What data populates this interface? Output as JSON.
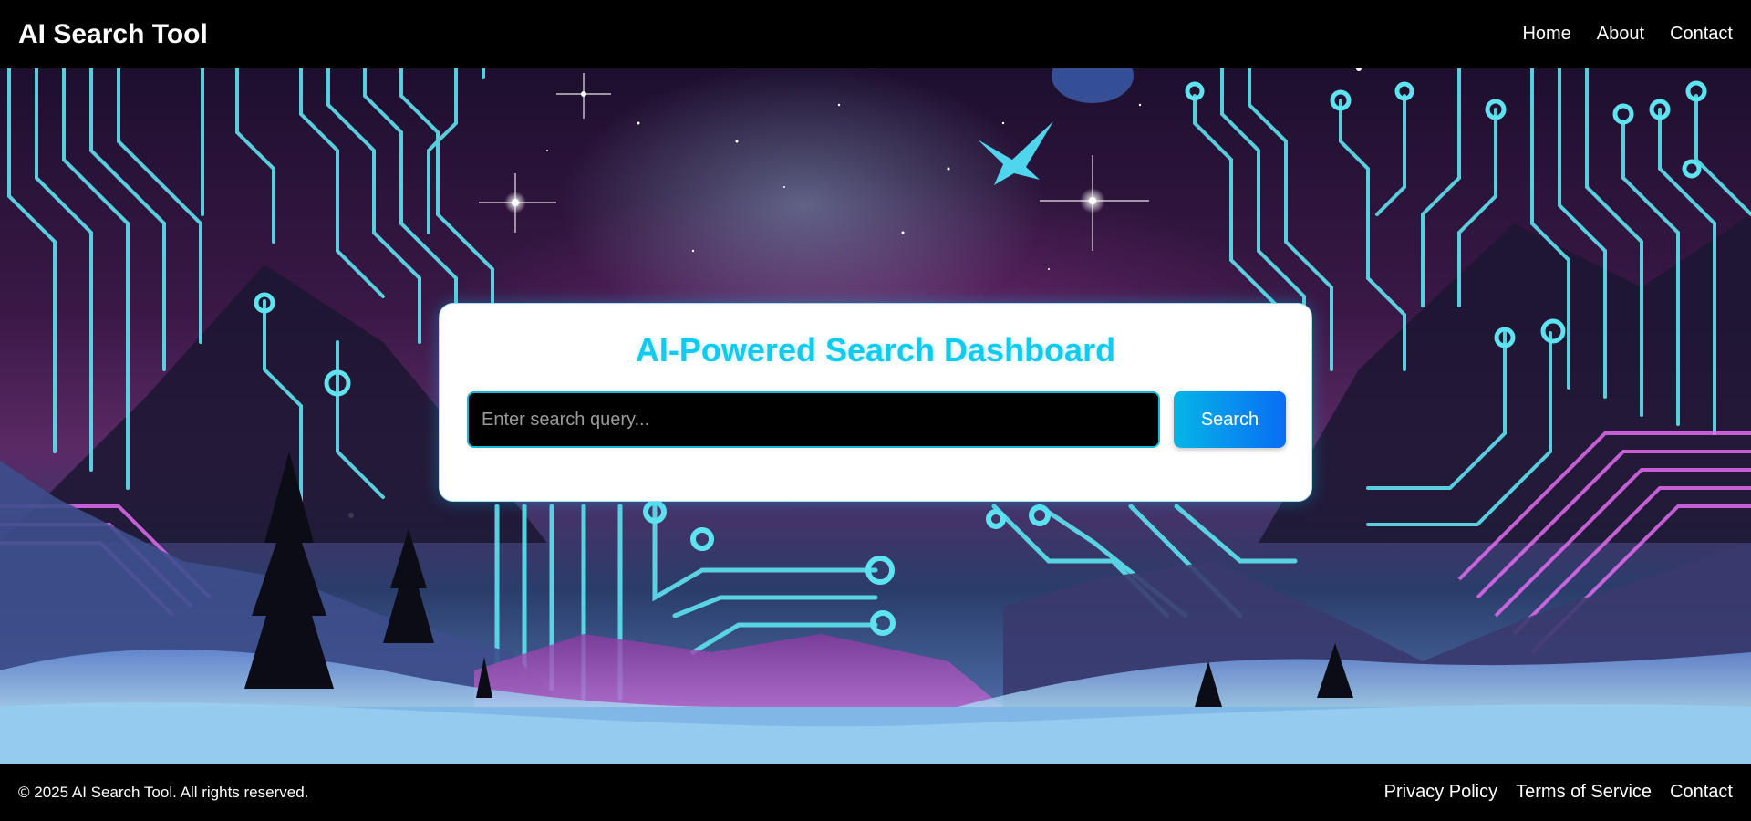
{
  "header": {
    "brand": "AI Search Tool",
    "nav": [
      "Home",
      "About",
      "Contact"
    ]
  },
  "main": {
    "title": "AI-Powered Search Dashboard",
    "search": {
      "value": "",
      "placeholder": "Enter search query...",
      "button_label": "Search"
    }
  },
  "footer": {
    "copyright": "© 2025 AI Search Tool. All rights reserved.",
    "links": [
      "Privacy Policy",
      "Terms of Service",
      "Contact"
    ]
  },
  "colors": {
    "accent": "#0fcbef",
    "button_start": "#05b5e6",
    "button_end": "#0a6df5",
    "circuit": "#5ee3f0",
    "circuit_pink": "#e36bf0",
    "header_bg": "#000000"
  }
}
